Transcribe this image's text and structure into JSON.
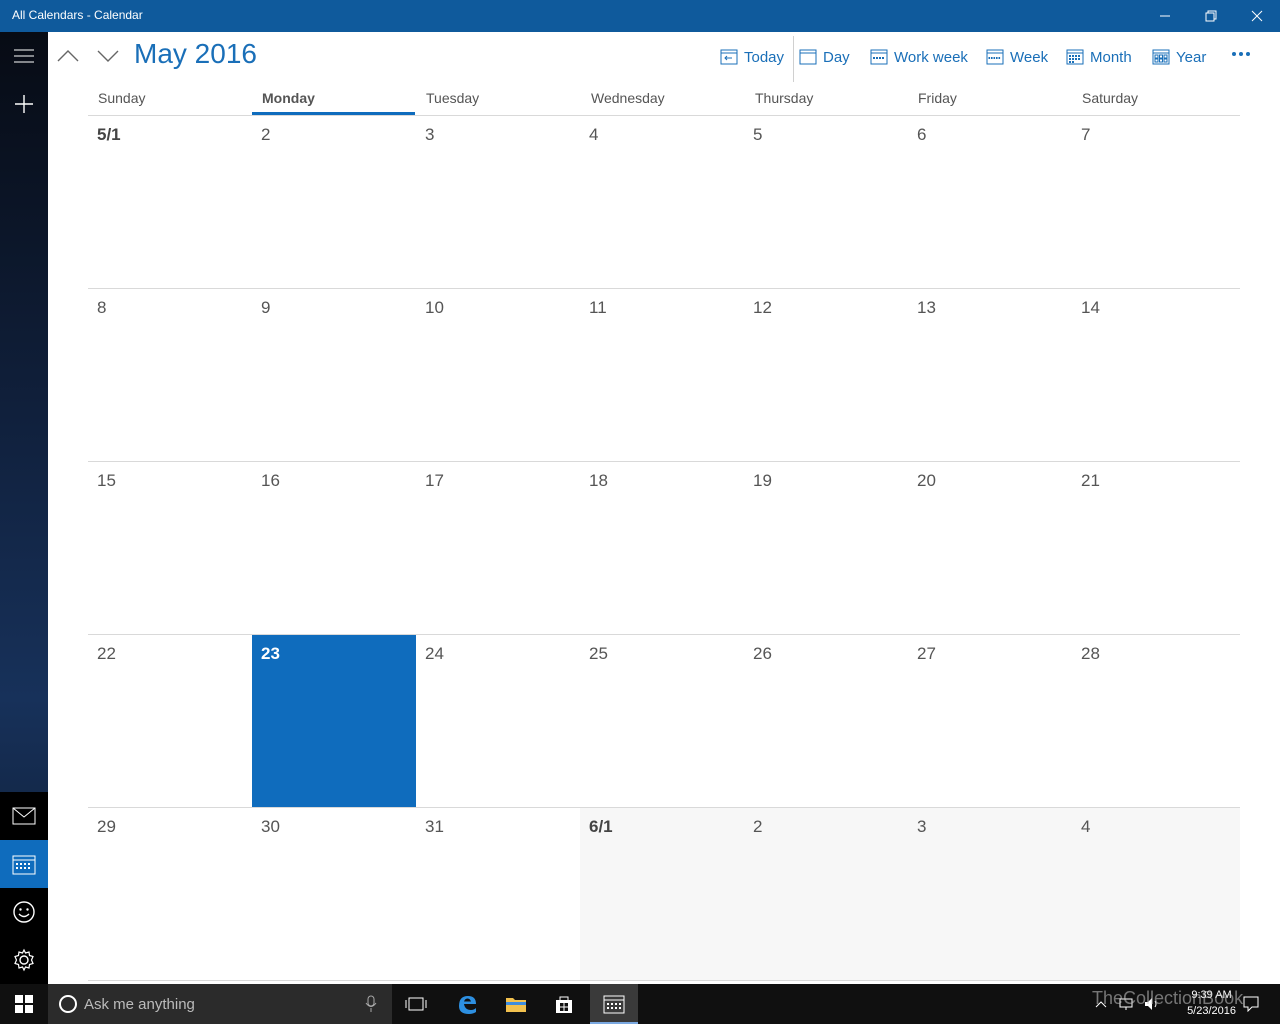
{
  "window": {
    "title": "All Calendars - Calendar"
  },
  "header": {
    "month_title": "May 2016",
    "toolbar": {
      "today": "Today",
      "day": "Day",
      "work_week": "Work week",
      "week": "Week",
      "month": "Month",
      "year": "Year"
    }
  },
  "weekdays": [
    "Sunday",
    "Monday",
    "Tuesday",
    "Wednesday",
    "Thursday",
    "Friday",
    "Saturday"
  ],
  "current_weekday_index": 1,
  "weeks": [
    [
      "5/1",
      "2",
      "3",
      "4",
      "5",
      "6",
      "7"
    ],
    [
      "8",
      "9",
      "10",
      "11",
      "12",
      "13",
      "14"
    ],
    [
      "15",
      "16",
      "17",
      "18",
      "19",
      "20",
      "21"
    ],
    [
      "22",
      "23",
      "24",
      "25",
      "26",
      "27",
      "28"
    ],
    [
      "29",
      "30",
      "31",
      "6/1",
      "2",
      "3",
      "4"
    ]
  ],
  "today_cell": {
    "week": 3,
    "day": 1
  },
  "taskbar": {
    "search_placeholder": "Ask me anything",
    "time": "9:39 AM",
    "date": "5/23/2016",
    "watermark": "TheCollectionBook"
  },
  "colors": {
    "accent": "#0f6cbd",
    "title_bar": "#0f5a9c",
    "header_text": "#1a6fb8"
  }
}
